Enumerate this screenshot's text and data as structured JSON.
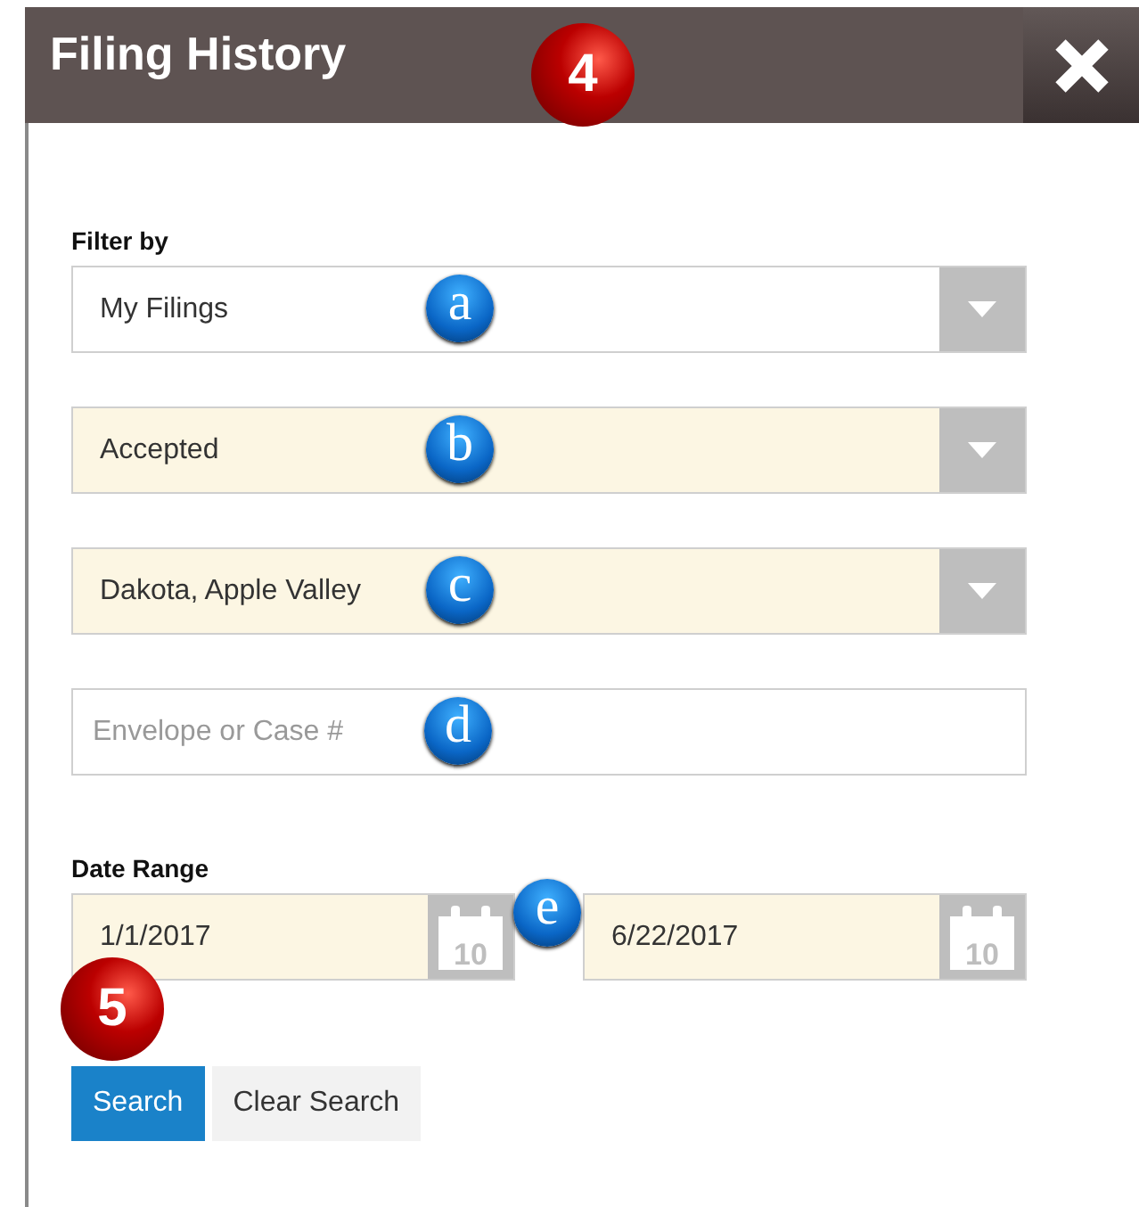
{
  "dialog": {
    "title": "Filing History",
    "callout": {
      "kind": "step",
      "label": "4"
    }
  },
  "filter": {
    "label": "Filter by",
    "fields": [
      {
        "kind": "select",
        "value": "My Filings",
        "highlighted": false,
        "callout": {
          "kind": "letter",
          "label": "a"
        }
      },
      {
        "kind": "select",
        "value": "Accepted",
        "highlighted": true,
        "callout": {
          "kind": "letter",
          "label": "b"
        }
      },
      {
        "kind": "select",
        "value": "Dakota, Apple Valley",
        "highlighted": true,
        "callout": {
          "kind": "letter",
          "label": "c"
        }
      },
      {
        "kind": "text",
        "placeholder": "Envelope or Case #",
        "highlighted": false,
        "callout": {
          "kind": "letter",
          "label": "d"
        }
      }
    ]
  },
  "date_range": {
    "label": "Date Range",
    "callout": {
      "kind": "letter",
      "label": "e"
    },
    "fields": [
      {
        "value": "1/1/2017",
        "calendar_day": "10"
      },
      {
        "value": "6/22/2017",
        "calendar_day": "10"
      }
    ]
  },
  "actions": {
    "callout": {
      "kind": "step",
      "label": "5"
    },
    "buttons": [
      {
        "label": "Search",
        "primary": true
      },
      {
        "label": "Clear Search",
        "primary": false
      }
    ]
  }
}
